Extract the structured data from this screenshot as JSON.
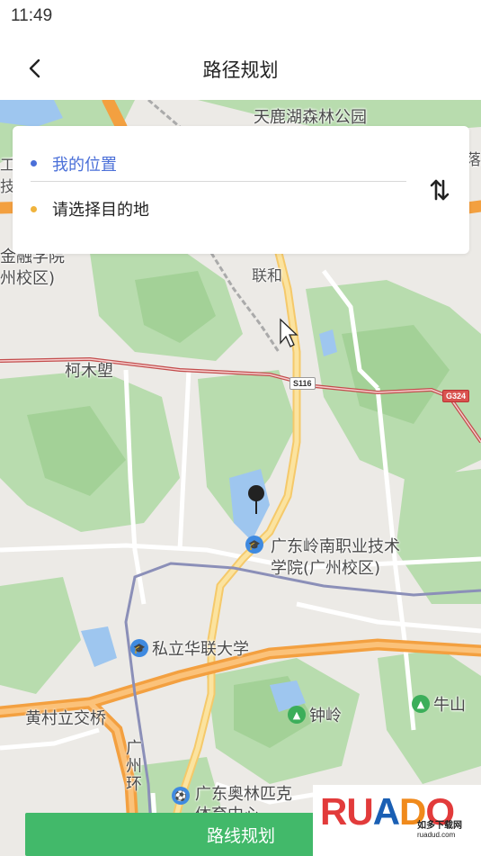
{
  "status_bar": {
    "time": "11:49"
  },
  "nav": {
    "title": "路径规划"
  },
  "route": {
    "from_label": "我的位置",
    "to_placeholder": "请选择目的地"
  },
  "map": {
    "labels": {
      "tianluhu": "天鹿湖森林公园",
      "jinrong": "金融学院",
      "jinrong_campus": "州校区)",
      "lianhe": "联和",
      "kemuliang": "柯木塱",
      "lingnan_line1": "广东岭南职业技术",
      "lingnan_line2": "学院(广州校区)",
      "hualian": "私立华联大学",
      "huangcun": "黄村立交桥",
      "zhongling": "钟岭",
      "niushan": "牛山",
      "guangzhou_ring": "广州环",
      "olympic": "广东奥林匹克",
      "olympic2": "体育中心",
      "left_gong": "工",
      "left_ji": "技",
      "right_luo": "落"
    },
    "shields": {
      "s116": "S116",
      "g324": "G324"
    }
  },
  "action": {
    "plan_label": "路线规划"
  },
  "watermark": {
    "logo": {
      "r": "R",
      "u": "U",
      "a": "A",
      "d": "D",
      "o": "O"
    },
    "sub": "如多下载网",
    "url": "ruadud.com"
  },
  "colors": {
    "accent_blue": "#4a6fd8",
    "destination_yellow": "#f0b33c",
    "button_green": "#42b96a",
    "map_green": "#a8d8a0",
    "highway_orange": "#f5a446"
  }
}
